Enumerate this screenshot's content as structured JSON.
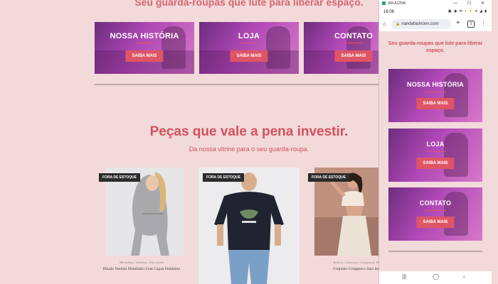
{
  "hero": {
    "tagline": "Seu guarda-roupas que lute para liberar espaço."
  },
  "promos": [
    {
      "title": "NOSSA HISTÓRIA",
      "button": "SAIBA MAIS"
    },
    {
      "title": "LOJA",
      "button": "SAIBA MAIS"
    },
    {
      "title": "CONTATO",
      "button": "SAIBA MAIS"
    }
  ],
  "products_section": {
    "title": "Peças que vale a pena investir.",
    "subtitle": "Da nossa vitrine para o seu guarda-roupa."
  },
  "products": [
    {
      "badge": "FORA DE ESTOQUE",
      "category": "Blusinhas, Vestidos, Macacões",
      "name": "Blusão Vestido Moletinho Com Capuz Feminino"
    },
    {
      "badge": "FORA DE ESTOQUE",
      "category": "",
      "name": ""
    },
    {
      "badge": "FORA DE ESTOQUE",
      "category": "Bolsos / Cinturas, Conjuntos, Feminino",
      "name": "Conjunto Cropped e Saia de Renda"
    }
  ],
  "emulator": {
    "window_title": "SM-A125M",
    "controls": "— ☐ ✕",
    "status_time": "16:06",
    "status_icons": "▣ ◉ ✉ •   ⚡ ▾ ◢ ▮",
    "url": "nandafashionn.com",
    "tabs_count": "3"
  },
  "mobile": {
    "tagline": "Seu guarda-roupas que lute para liberar espaço.",
    "promos": [
      {
        "title": "NOSSA HISTÓRIA",
        "button": "SAIBA MAIS"
      },
      {
        "title": "LOJA",
        "button": "SAIBA MAIS"
      },
      {
        "title": "CONTATO",
        "button": "SAIBA MAIS"
      }
    ]
  },
  "colors": {
    "background": "#f2d9da",
    "accent": "#d1525d",
    "button": "#df5565",
    "badge": "#2b2b2b",
    "promo_gradient_start": "#6d2d7e",
    "promo_gradient_end": "#d679c9"
  },
  "icons": [
    "home-icon",
    "lock-icon",
    "plus-icon",
    "tabs-icon",
    "menu-icon",
    "recents-nav-icon",
    "home-nav-icon",
    "back-nav-icon"
  ]
}
